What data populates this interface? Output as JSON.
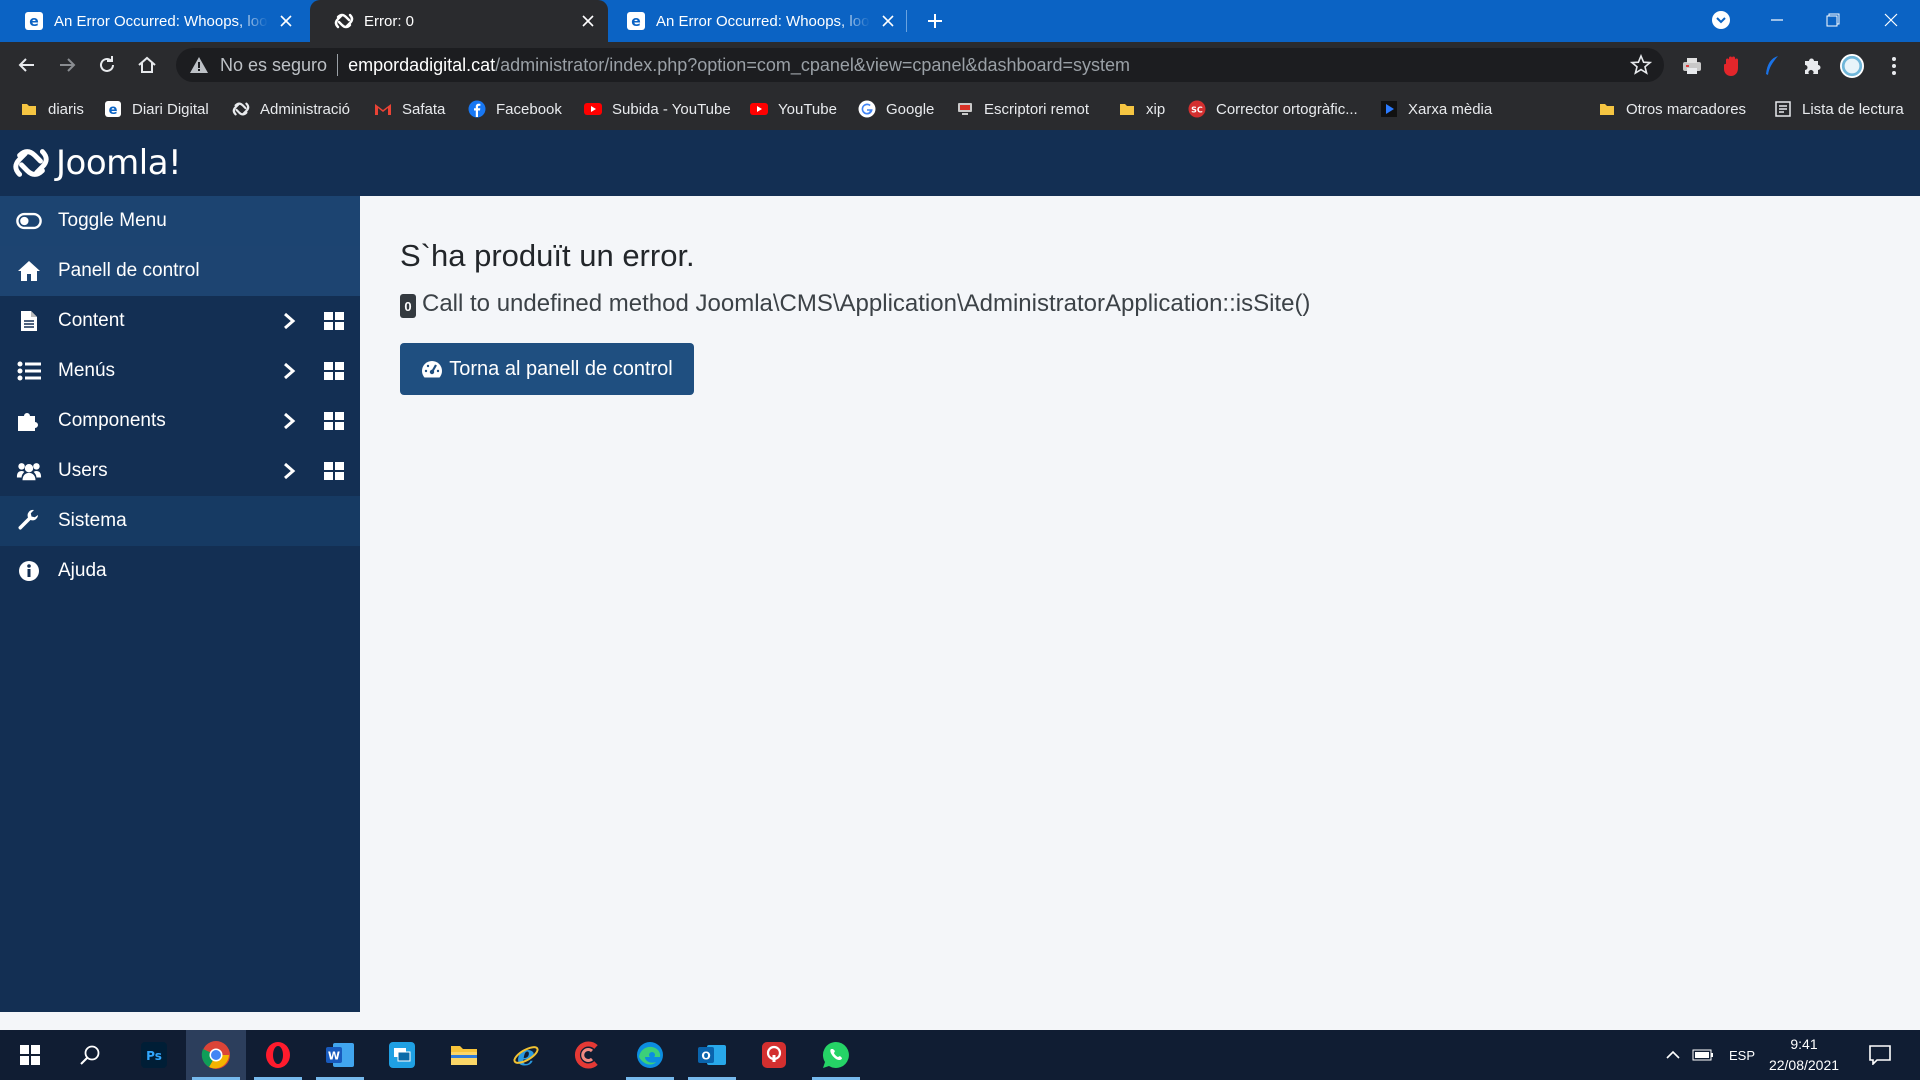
{
  "browser": {
    "tabs": [
      {
        "title": "An Error Occurred: Whoops, looks like something went wrong.",
        "active": false
      },
      {
        "title": "Error: 0",
        "active": true
      },
      {
        "title": "An Error Occurred: Whoops, looks like something went wrong.",
        "active": false
      }
    ],
    "security_label": "No es seguro",
    "url_host": "empordadigital.cat",
    "url_path": "/administrator/index.php?option=com_cpanel&view=cpanel&dashboard=system",
    "bookmarks": [
      {
        "label": "diaris",
        "icon": "folder-icon"
      },
      {
        "label": "Diari Digital",
        "icon": "site-icon"
      },
      {
        "label": "Administració",
        "icon": "joomla-icon"
      },
      {
        "label": "Safata",
        "icon": "gmail-icon"
      },
      {
        "label": "Facebook",
        "icon": "facebook-icon"
      },
      {
        "label": "Subida - YouTube",
        "icon": "youtube-icon"
      },
      {
        "label": "YouTube",
        "icon": "youtube-icon"
      },
      {
        "label": "Google",
        "icon": "google-icon"
      },
      {
        "label": "Escriptori remot",
        "icon": "remote-desktop-icon"
      },
      {
        "label": "xip",
        "icon": "folder-icon"
      },
      {
        "label": "Corrector ortogràfic...",
        "icon": "sc-icon"
      },
      {
        "label": "Xarxa mèdia",
        "icon": "play-icon"
      }
    ],
    "other_bookmarks": "Otros marcadores",
    "reading_list": "Lista de lectura"
  },
  "joomla": {
    "logo_text": "Joomla!",
    "menu": [
      {
        "label": "Toggle Menu",
        "icon": "toggle-icon",
        "submenu": false
      },
      {
        "label": "Panell de control",
        "icon": "home-icon",
        "submenu": false
      },
      {
        "label": "Content",
        "icon": "file-icon",
        "submenu": true
      },
      {
        "label": "Menús",
        "icon": "list-icon",
        "submenu": true
      },
      {
        "label": "Components",
        "icon": "puzzle-icon",
        "submenu": true
      },
      {
        "label": "Users",
        "icon": "users-icon",
        "submenu": true
      },
      {
        "label": "Sistema",
        "icon": "wrench-icon",
        "submenu": false
      },
      {
        "label": "Ajuda",
        "icon": "info-icon",
        "submenu": false
      }
    ],
    "error": {
      "title": "S`ha produït un error.",
      "code": "0",
      "message": "Call to undefined method Joomla\\CMS\\Application\\AdministratorApplication::isSite()",
      "button_label": "Torna al panell de control"
    }
  },
  "taskbar": {
    "language": "ESP",
    "time": "9:41",
    "date": "22/08/2021"
  },
  "colors": {
    "chrome_tabstrip": "#0b63c4",
    "chrome_toolbar": "#2a2b2e",
    "joomla_sidebar": "#132f53",
    "joomla_button": "#1f4f80",
    "content_bg": "#f4f6f9",
    "taskbar": "#101d33"
  }
}
